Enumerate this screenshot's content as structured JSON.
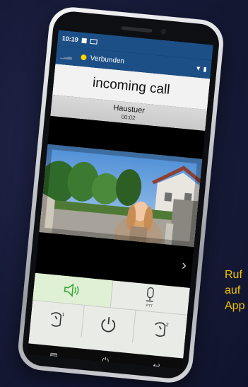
{
  "caption": {
    "lines": [
      "Ruf",
      "auf",
      "App"
    ]
  },
  "status": {
    "time": "10:19"
  },
  "appbar": {
    "connection_label": "Verbunden",
    "connection_color": "#ffd400"
  },
  "call": {
    "title": "incoming call",
    "station_name": "Haustuer",
    "duration": "00:02"
  },
  "controls": {
    "speaker_icon": "speaker-icon",
    "ptt_label": "PTT",
    "door1_label": "1",
    "door2_label": "2"
  },
  "nav": {
    "items": [
      "recent-apps-icon",
      "power-icon",
      "back-icon"
    ]
  },
  "colors": {
    "accent_blue": "#1c4f86",
    "speaker_green": "#3aa63a",
    "caption_yellow": "#f2c400"
  }
}
